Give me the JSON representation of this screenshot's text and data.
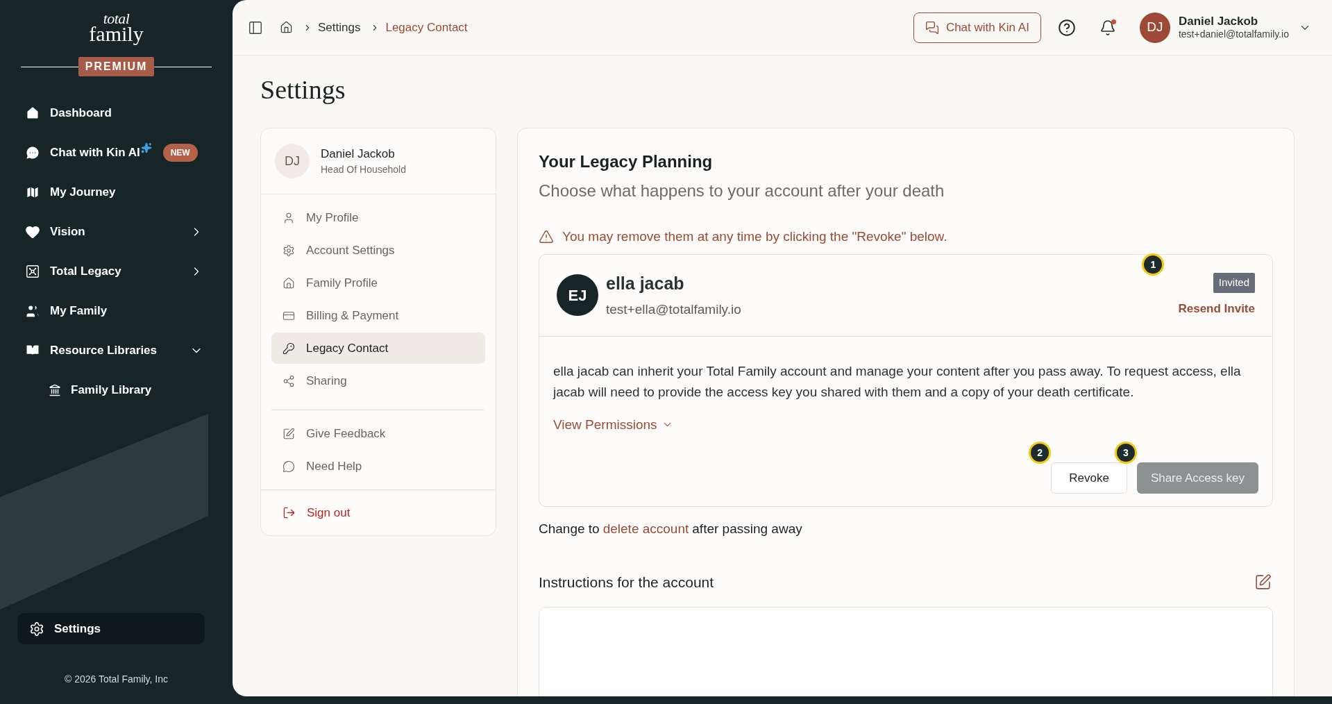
{
  "sidebar": {
    "logo_top": "total",
    "logo_bottom": "family",
    "plan_badge": "PREMIUM",
    "items": [
      {
        "label": "Dashboard"
      },
      {
        "label": "Chat with Kin AI",
        "sparkle": true,
        "badge": "NEW"
      },
      {
        "label": "My Journey"
      },
      {
        "label": "Vision",
        "expanded": false
      },
      {
        "label": "Total Legacy",
        "expanded": false
      },
      {
        "label": "My Family"
      },
      {
        "label": "Resource Libraries",
        "expanded": true,
        "children": [
          {
            "label": "Family Library"
          }
        ]
      }
    ],
    "settings": {
      "label": "Settings",
      "selected": true
    },
    "copyright": "© 2026 Total Family, Inc"
  },
  "topbar": {
    "breadcrumbs": [
      {
        "label": "Settings",
        "current": false
      },
      {
        "label": "Legacy Contact",
        "current": true
      }
    ],
    "chat_button": "Chat with Kin AI",
    "notification_dot": true,
    "user": {
      "initials": "DJ",
      "name": "Daniel Jackob",
      "email": "test+daniel@totalfamily.io"
    }
  },
  "page_title": "Settings",
  "settings_nav": {
    "profile": {
      "initials": "DJ",
      "name": "Daniel Jackob",
      "role": "Head Of Household"
    },
    "groups": [
      [
        {
          "label": "My Profile",
          "selected": false
        },
        {
          "label": "Account Settings",
          "selected": false
        },
        {
          "label": "Family Profile",
          "selected": false
        },
        {
          "label": "Billing & Payment",
          "selected": false
        },
        {
          "label": "Legacy Contact",
          "selected": true
        },
        {
          "label": "Sharing",
          "selected": false
        }
      ],
      [
        {
          "label": "Give Feedback",
          "selected": false
        },
        {
          "label": "Need Help",
          "selected": false
        }
      ]
    ],
    "sign_out": "Sign out"
  },
  "legacy": {
    "title": "Your Legacy Planning",
    "subtitle": "Choose what happens to your account after your death",
    "warning": "You may remove them at any time by clicking the \"Revoke\" below.",
    "contact": {
      "initials": "EJ",
      "name": "ella jacab",
      "email": "test+ella@totalfamily.io",
      "status": "Invited",
      "status_marker": "1",
      "resend": "Resend Invite",
      "description": "ella jacab can inherit your Total Family account and manage your content after you pass away. To request access, ella jacab will need to provide the access key you shared with them and a copy of your death certificate.",
      "permissions_link": "View Permissions",
      "permissions_expanded": false,
      "buttons": [
        {
          "label": "Revoke",
          "kind": "outline",
          "marker": "2",
          "disabled": false
        },
        {
          "label": "Share Access key",
          "kind": "solid",
          "marker": "3",
          "disabled": true
        }
      ]
    },
    "change_prefix": "Change to",
    "change_link": "delete account",
    "change_suffix": "after passing away",
    "instructions_title": "Instructions for the account"
  }
}
